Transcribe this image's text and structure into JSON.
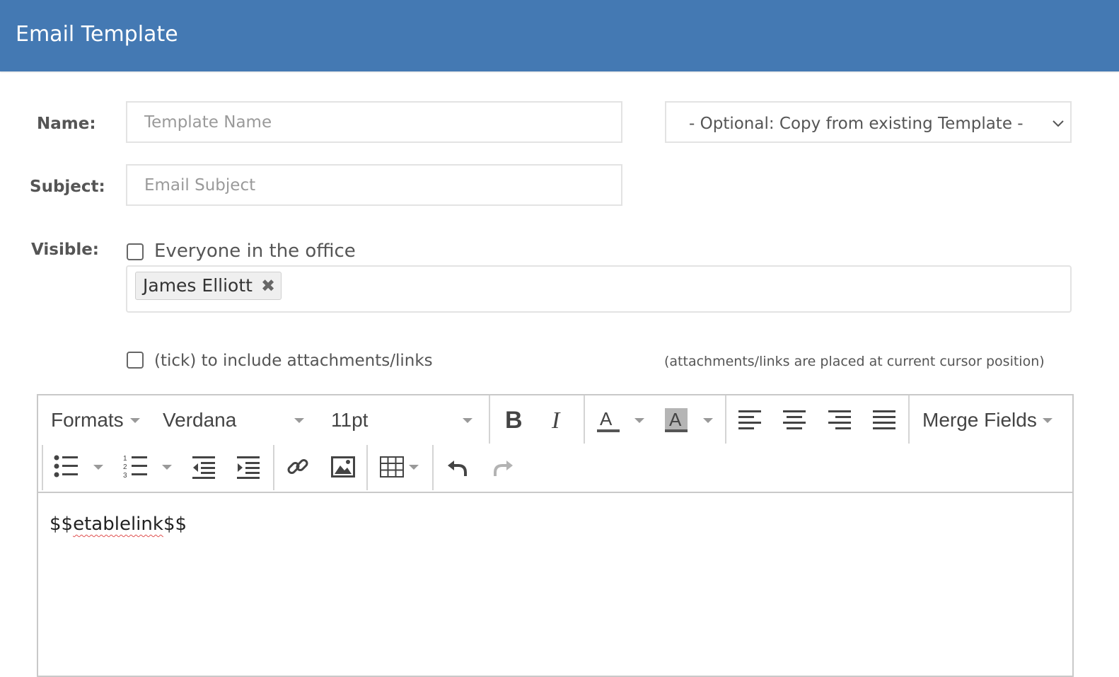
{
  "header": {
    "title": "Email Template"
  },
  "form": {
    "name_label": "Name:",
    "name_placeholder": "Template Name",
    "subject_label": "Subject:",
    "subject_placeholder": "Email Subject",
    "copy_select_value": "- Optional: Copy from existing Template -",
    "visible_label": "Visible:",
    "everyone_checkbox_label": "Everyone in the office",
    "everyone_checked": false,
    "visible_tags": [
      {
        "label": "James Elliott"
      }
    ],
    "attachments_checkbox_label": "(tick) to include attachments/links",
    "attachments_checked": false,
    "attachments_hint": "(attachments/links are placed at current cursor position)"
  },
  "editor": {
    "toolbar": {
      "formats_label": "Formats",
      "font_family": "Verdana",
      "font_size": "11pt",
      "merge_fields_label": "Merge Fields",
      "icons": [
        "bold-icon",
        "italic-icon",
        "text-color-icon",
        "background-color-icon",
        "align-left-icon",
        "align-center-icon",
        "align-right-icon",
        "align-justify-icon",
        "bullet-list-icon",
        "numbered-list-icon",
        "outdent-icon",
        "indent-icon",
        "link-icon",
        "image-icon",
        "table-icon",
        "undo-icon",
        "redo-icon"
      ]
    },
    "content_prefix": "$$",
    "content_word": "etablelink",
    "content_suffix": "$$"
  },
  "colors": {
    "header_bg": "#4479b3",
    "header_text": "#ffffff",
    "border": "#e3e3e3"
  }
}
